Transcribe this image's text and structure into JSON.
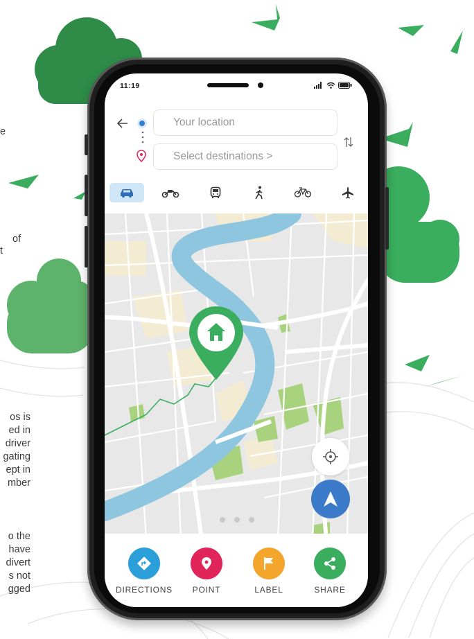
{
  "status": {
    "time": "11:19"
  },
  "route": {
    "origin_placeholder": "Your location",
    "destination_placeholder": "Select destinations  >"
  },
  "transport_modes": [
    {
      "name": "car",
      "active": true
    },
    {
      "name": "motorbike",
      "active": false
    },
    {
      "name": "bus",
      "active": false
    },
    {
      "name": "walk",
      "active": false
    },
    {
      "name": "bicycle",
      "active": false
    },
    {
      "name": "plane",
      "active": false
    }
  ],
  "map": {
    "pager": {
      "pages": 3,
      "active": 1
    }
  },
  "actions": [
    {
      "label": "DIRECTIONS",
      "color": "#2b9fd9"
    },
    {
      "label": "POINT",
      "color": "#e0255a"
    },
    {
      "label": "LABEL",
      "color": "#f4a52c"
    },
    {
      "label": "SHARE",
      "color": "#3aae5e"
    }
  ],
  "side_text": {
    "top": "e",
    "mid_1": "of",
    "mid_2": "t",
    "bottom_lines": [
      "os  is",
      "ed in",
      "driver",
      "gating",
      "ept  in",
      "mber",
      "",
      "o  the",
      "have",
      "divert",
      "s  not",
      "gged"
    ]
  },
  "colors": {
    "accent_blue": "#3b7bc9",
    "cloud_dark": "#2e8b48",
    "cloud_light": "#5db36b",
    "river": "#8ec6e0",
    "park": "#a9d27f",
    "land": "#f4ecd2"
  }
}
